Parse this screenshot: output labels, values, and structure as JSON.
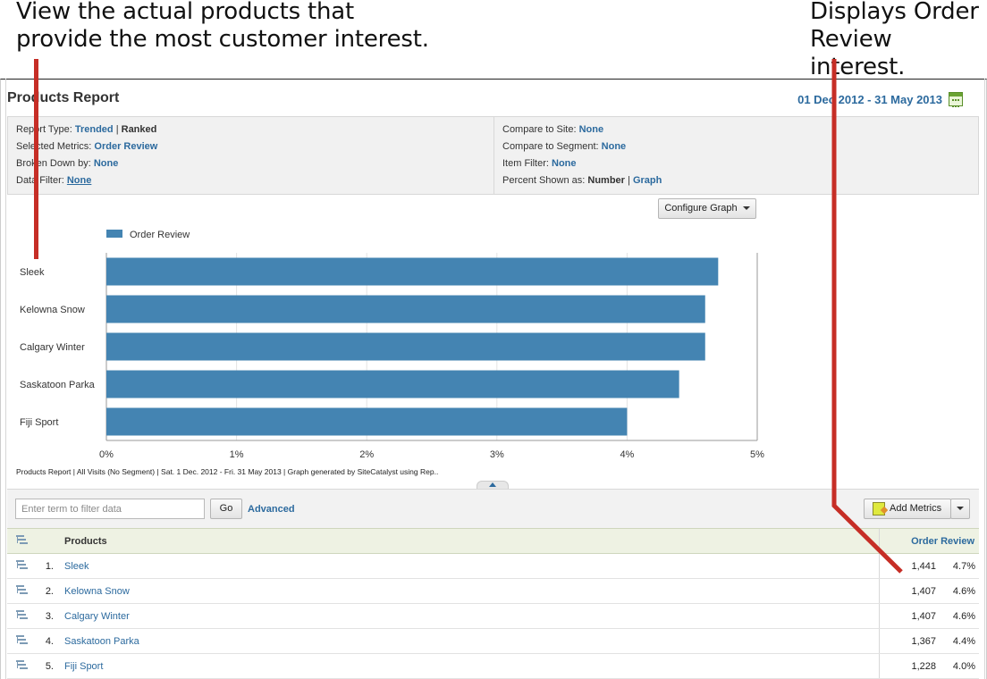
{
  "callouts": {
    "left": "View the actual products that provide the most customer interest.",
    "right": "Displays Order Review interest."
  },
  "header": {
    "title": "Products Report",
    "date_range": "01 Dec 2012 - 31 May 2013"
  },
  "settings": {
    "left": [
      {
        "label": "Report Type: ",
        "links": [
          "Trended"
        ],
        "sep": " | ",
        "extra": "Ranked"
      },
      {
        "label": "Selected Metrics: ",
        "value": "Order Review"
      },
      {
        "label": "Broken Down by: ",
        "value": "None"
      },
      {
        "label": "Data Filter: ",
        "value": "None"
      }
    ],
    "right": [
      {
        "label": "Compare to Site: ",
        "value": "None"
      },
      {
        "label": "Compare to Segment: ",
        "value": "None"
      },
      {
        "label": "Item Filter: ",
        "value": "None"
      },
      {
        "label": "Percent Shown as: ",
        "strong": "Number",
        "sep": " | ",
        "link": "Graph"
      }
    ]
  },
  "configure_graph_label": "Configure Graph",
  "chart_data": {
    "type": "bar",
    "orientation": "horizontal",
    "categories": [
      "Sleek",
      "Kelowna Snow",
      "Calgary Winter",
      "Saskatoon Parka",
      "Fiji Sport"
    ],
    "series": [
      {
        "name": "Order Review",
        "values": [
          4.7,
          4.6,
          4.6,
          4.4,
          4.0
        ]
      }
    ],
    "x_ticks": [
      "0%",
      "1%",
      "2%",
      "3%",
      "4%",
      "5%"
    ],
    "xlim": [
      0,
      5
    ],
    "grid": true,
    "legend": "top-left",
    "color": "#4484b2"
  },
  "chart_footer": "Products Report | All Visits (No Segment) | Sat.  1 Dec. 2012 - Fri. 31 May 2013 | Graph generated by SiteCatalyst using Rep..",
  "toolbar": {
    "filter_placeholder": "Enter term to filter data",
    "go_label": "Go",
    "advanced_label": "Advanced",
    "add_metrics_label": "Add Metrics"
  },
  "table": {
    "headers": {
      "name": "Products",
      "metric": "Order Review"
    },
    "rows": [
      {
        "rank": "1.",
        "name": "Sleek",
        "value": "1,441",
        "pct": "4.7%"
      },
      {
        "rank": "2.",
        "name": "Kelowna Snow",
        "value": "1,407",
        "pct": "4.6%"
      },
      {
        "rank": "3.",
        "name": "Calgary Winter",
        "value": "1,407",
        "pct": "4.6%"
      },
      {
        "rank": "4.",
        "name": "Saskatoon Parka",
        "value": "1,367",
        "pct": "4.4%"
      },
      {
        "rank": "5.",
        "name": "Fiji Sport",
        "value": "1,228",
        "pct": "4.0%"
      }
    ]
  }
}
